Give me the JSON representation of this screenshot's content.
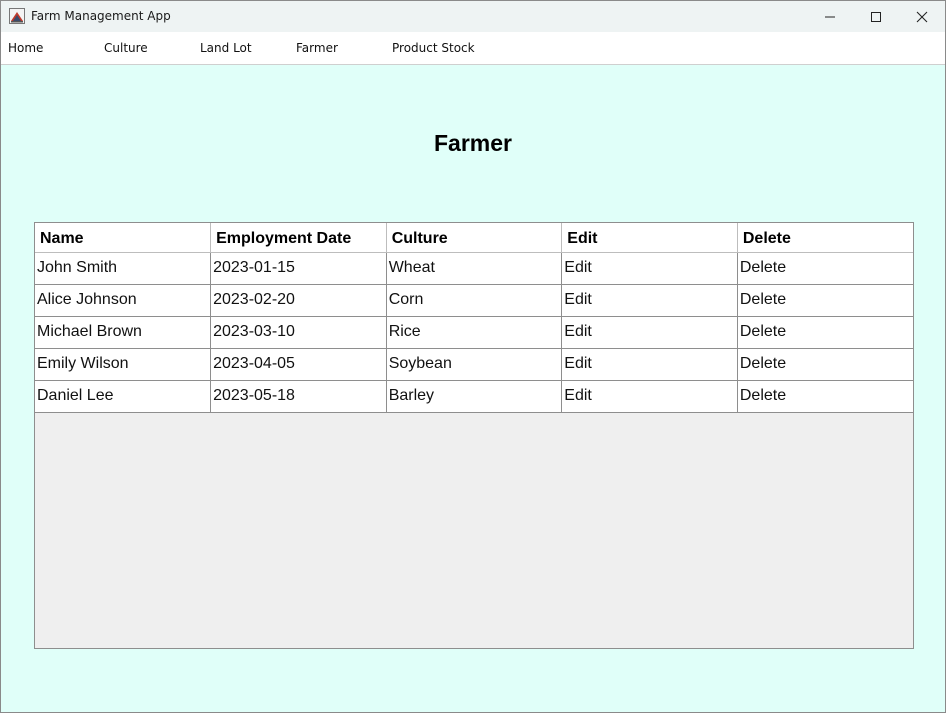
{
  "window": {
    "title": "Farm Management App"
  },
  "menu": {
    "items": [
      "Home",
      "Culture",
      "Land Lot",
      "Farmer",
      "Product Stock"
    ]
  },
  "page": {
    "title": "Farmer"
  },
  "table": {
    "columns": [
      "Name",
      "Employment Date",
      "Culture",
      "Edit",
      "Delete"
    ],
    "rows": [
      [
        "John Smith",
        "2023-01-15",
        "Wheat",
        "Edit",
        "Delete"
      ],
      [
        "Alice Johnson",
        "2023-02-20",
        "Corn",
        "Edit",
        "Delete"
      ],
      [
        "Michael Brown",
        "2023-03-10",
        "Rice",
        "Edit",
        "Delete"
      ],
      [
        "Emily Wilson",
        "2023-04-05",
        "Soybean",
        "Edit",
        "Delete"
      ],
      [
        "Daniel Lee",
        "2023-05-18",
        "Barley",
        "Edit",
        "Delete"
      ]
    ]
  },
  "colors": {
    "content_background": "#e0fff9",
    "titlebar_background": "#eef3f3",
    "table_empty_area": "#efefef"
  },
  "icons": {
    "app": "java-app-icon",
    "minimize": "minimize-icon",
    "maximize": "maximize-icon",
    "close": "close-icon"
  }
}
